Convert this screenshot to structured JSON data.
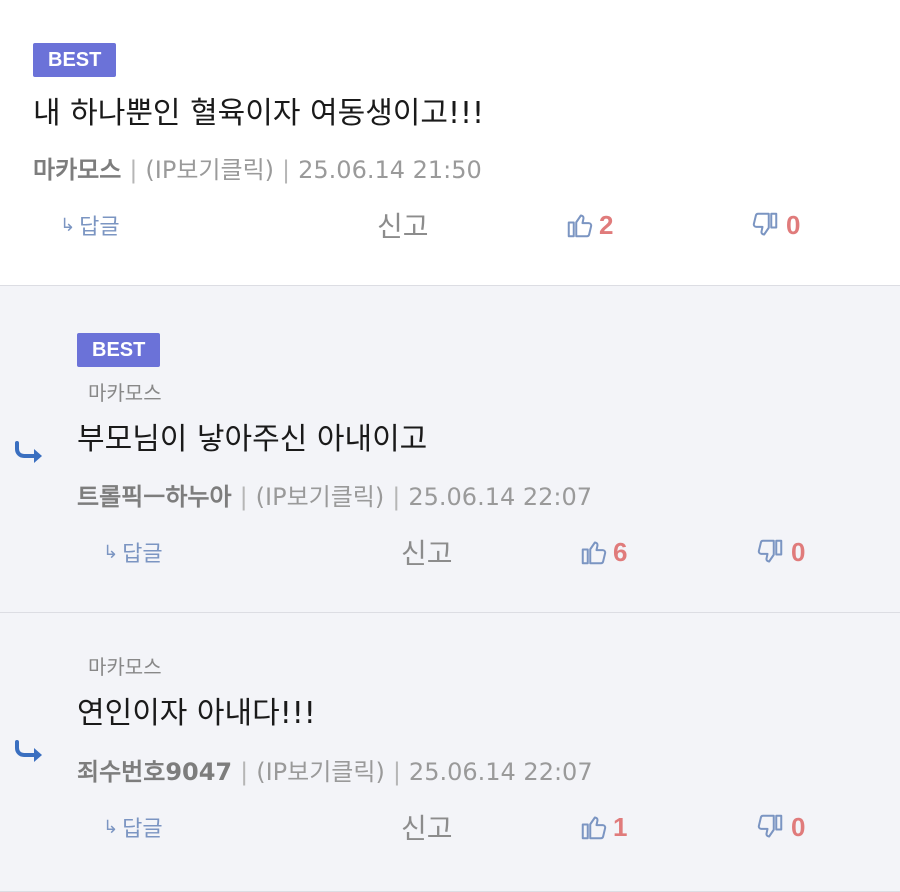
{
  "comments": [
    {
      "best_label": "BEST",
      "text": "내 하나뿐인 혈육이자 여동생이고!!!",
      "author": "마카모스",
      "ip_label": "(IP보기클릭)",
      "datetime": "25.06.14 21:50",
      "reply_label": "답글",
      "reply_arrow": "↳",
      "report_label": "신고",
      "likes": "2",
      "dislikes": "0"
    },
    {
      "best_label": "BEST",
      "mention": "마카모스",
      "text": "부모님이 낳아주신 아내이고",
      "author": "트롤픽ㅡ하누아",
      "ip_label": "(IP보기클릭)",
      "datetime": "25.06.14 22:07",
      "reply_label": "답글",
      "reply_arrow": "↳",
      "report_label": "신고",
      "likes": "6",
      "dislikes": "0"
    },
    {
      "mention": "마카모스",
      "text": "연인이자 아내다!!!",
      "author": "죄수번호9047",
      "ip_label": "(IP보기클릭)",
      "datetime": "25.06.14 22:07",
      "reply_label": "답글",
      "reply_arrow": "↳",
      "report_label": "신고",
      "likes": "1",
      "dislikes": "0"
    }
  ],
  "colors": {
    "best_badge": "#6b72d8",
    "reply_background": "#f3f4f8",
    "count": "#e07b7b",
    "icon": "#7b95c2",
    "reply_indicator": "#3a6fc0"
  },
  "icons": {
    "like": "thumbs-up-icon",
    "dislike": "thumbs-down-icon",
    "reply_indicator": "reply-arrow-icon"
  }
}
